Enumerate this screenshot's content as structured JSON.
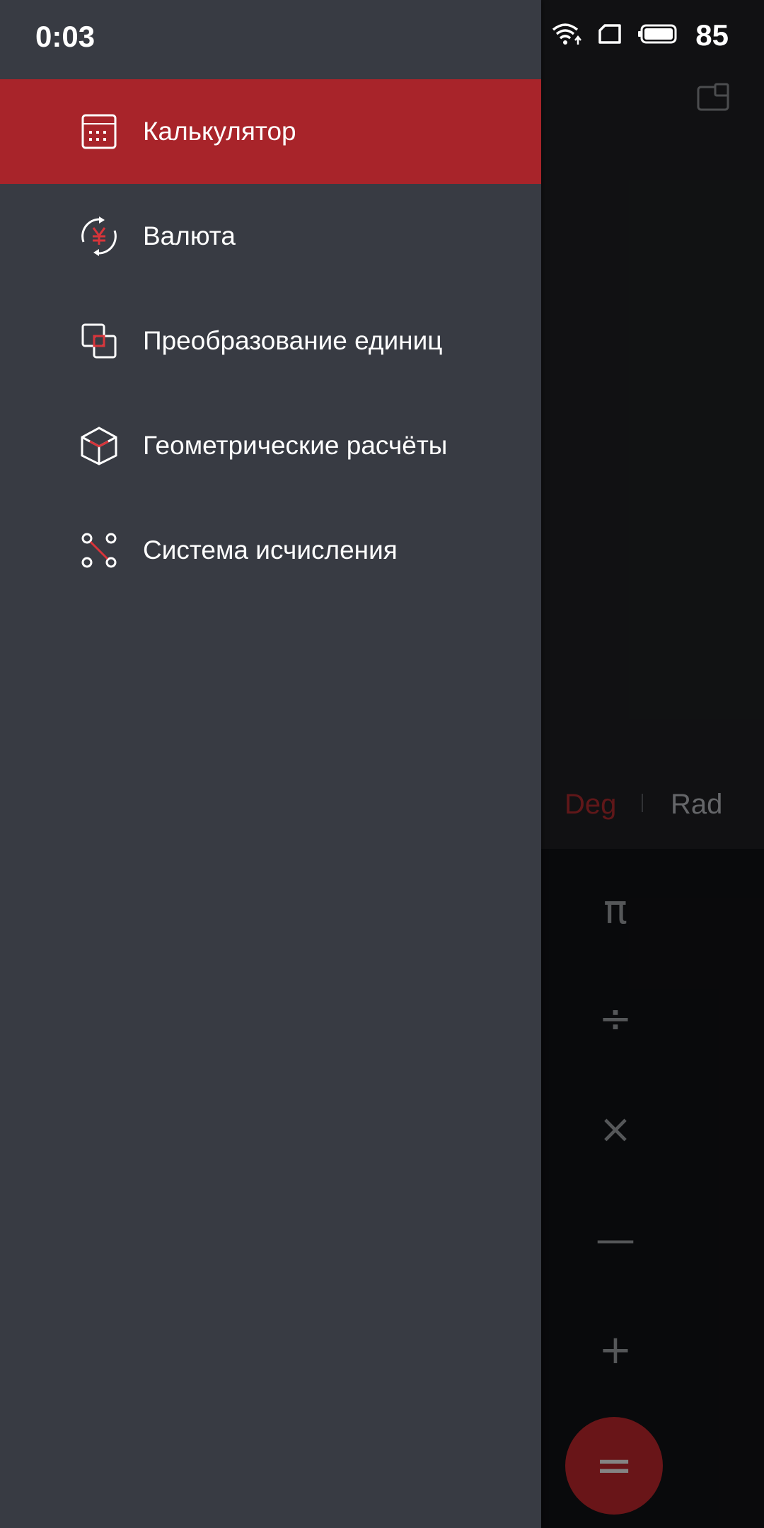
{
  "status_bar": {
    "time": "0:03",
    "battery_percent": "85",
    "icons": [
      "wifi-icon",
      "sim-icon",
      "battery-icon"
    ]
  },
  "drawer": {
    "items": [
      {
        "label": "Калькулятор",
        "icon": "calculator-icon",
        "active": true
      },
      {
        "label": "Валюта",
        "icon": "currency-exchange-icon",
        "active": false
      },
      {
        "label": "Преобразование единиц",
        "icon": "unit-conversion-icon",
        "active": false
      },
      {
        "label": "Геометрические расчёты",
        "icon": "geometry-cube-icon",
        "active": false
      },
      {
        "label": "Система исчисления",
        "icon": "number-system-icon",
        "active": false
      }
    ]
  },
  "calculator": {
    "angle_modes": {
      "deg": "Deg",
      "rad": "Rad",
      "selected": "Deg"
    },
    "keys": [
      "π",
      "÷",
      "×",
      "—",
      "+"
    ],
    "equals": "="
  },
  "colors": {
    "accent": "#a8242a",
    "drawer_bg": "#383b43",
    "text": "#ffffff"
  }
}
